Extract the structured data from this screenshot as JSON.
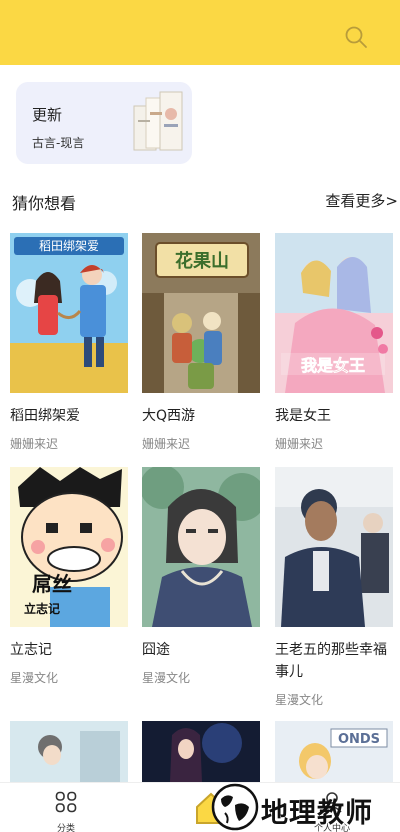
{
  "header": {
    "search_icon": "search-icon",
    "bg_color": "#fbd844"
  },
  "update_card": {
    "title": "更新",
    "subtitle": "古言-现言"
  },
  "section": {
    "title": "猜你想看",
    "more": "查看更多>"
  },
  "comics": [
    {
      "title": "稻田绑架爱",
      "author": "姗姗来迟"
    },
    {
      "title": "大Q西游",
      "author": "姗姗来迟"
    },
    {
      "title": "我是女王",
      "author": "姗姗来迟"
    },
    {
      "title": "立志记",
      "author": "星漫文化"
    },
    {
      "title": "囧途",
      "author": "星漫文化"
    },
    {
      "title": "王老五的那些幸福事儿",
      "author": "星漫文化"
    }
  ],
  "cover_texts": {
    "c1": "稻田绑架爱",
    "c2": "花果山",
    "c3": "我是女王",
    "c4a": "屌丝",
    "c4b": "立志记",
    "c9": "ONDS"
  },
  "tabbar": {
    "classify_label": "分类",
    "personal_label": "个人中心"
  },
  "watermark": {
    "text": "地理教师"
  }
}
